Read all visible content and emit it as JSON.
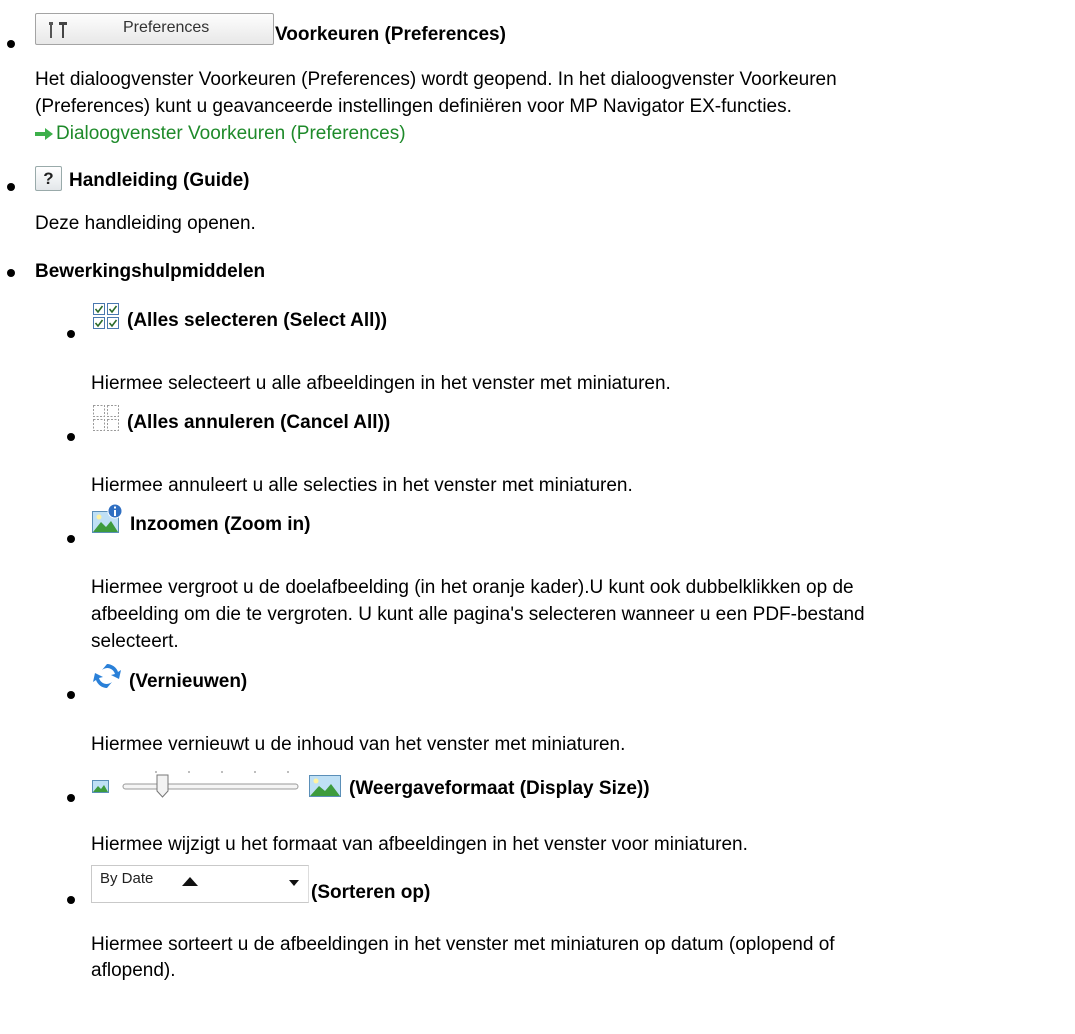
{
  "items": [
    {
      "title": "Voorkeuren (Preferences)",
      "button_label": "Preferences",
      "icon": "tools-icon",
      "desc_line1": "Het dialoogvenster Voorkeuren (Preferences) wordt geopend. In het dialoogvenster Voorkeuren",
      "desc_line2": "(Preferences) kunt u geavanceerde instellingen definiëren voor MP Navigator EX-functies.",
      "link": "Dialoogvenster Voorkeuren (Preferences)"
    },
    {
      "title": "Handleiding (Guide)",
      "icon_text": "?",
      "icon": "help-icon",
      "desc": "Deze handleiding openen."
    },
    {
      "title": "Bewerkingshulpmiddelen"
    }
  ],
  "tools": [
    {
      "title": "(Alles selecteren (Select All))",
      "icon": "select-all-icon",
      "desc": "Hiermee selecteert u alle afbeeldingen in het venster met miniaturen."
    },
    {
      "title": "(Alles annuleren (Cancel All))",
      "icon": "cancel-all-icon",
      "desc": "Hiermee annuleert u alle selecties in het venster met miniaturen."
    },
    {
      "title": "Inzoomen (Zoom in)",
      "icon": "zoom-in-icon",
      "desc_line1": "Hiermee vergroot u de doelafbeelding (in het oranje kader).U kunt ook dubbelklikken op de",
      "desc_line2": "afbeelding om die te vergroten. U kunt alle pagina's selecteren wanneer u een PDF-bestand",
      "desc_line3": "selecteert."
    },
    {
      "title": "(Vernieuwen)",
      "icon": "refresh-icon",
      "desc": "Hiermee vernieuwt u de inhoud van het venster met miniaturen."
    },
    {
      "title": "(Weergaveformaat (Display Size))",
      "icon": "display-size-slider",
      "slider_level": 0.32,
      "desc": "Hiermee wijzigt u het formaat van afbeeldingen in het venster voor miniaturen."
    },
    {
      "title": "(Sorteren op)",
      "sort_label": "By Date",
      "desc_line1": "Hiermee sorteert u de afbeeldingen in het venster met miniaturen op datum (oplopend of",
      "desc_line2": "aflopend)."
    }
  ],
  "colors": {
    "link": "#1e8a2a"
  }
}
